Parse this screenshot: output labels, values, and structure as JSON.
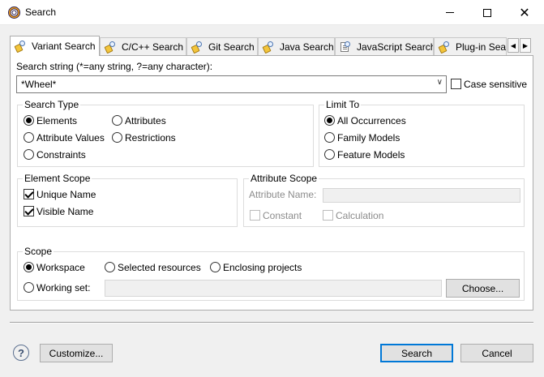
{
  "window": {
    "title": "Search"
  },
  "tabs": [
    {
      "label": "Variant Search",
      "icon": "search-wand-icon"
    },
    {
      "label": "C/C++ Search",
      "icon": "search-wand-icon"
    },
    {
      "label": "Git Search",
      "icon": "search-wand-icon"
    },
    {
      "label": "Java Search",
      "icon": "search-wand-icon"
    },
    {
      "label": "JavaScript Search",
      "icon": "document-search-icon"
    },
    {
      "label": "Plug-in Sea",
      "icon": "search-wand-icon"
    }
  ],
  "search": {
    "label": "Search string (*=any string, ?=any character):",
    "value": "*Wheel*",
    "case_sensitive_label": "Case sensitive",
    "case_sensitive": false
  },
  "search_type": {
    "title": "Search Type",
    "options": [
      "Elements",
      "Attributes",
      "Attribute Values",
      "Restrictions",
      "Constraints"
    ],
    "selected": "Elements"
  },
  "limit_to": {
    "title": "Limit To",
    "options": [
      "All Occurrences",
      "Family Models",
      "Feature Models"
    ],
    "selected": "All Occurrences"
  },
  "element_scope": {
    "title": "Element Scope",
    "unique_name": "Unique Name",
    "visible_name": "Visible Name",
    "unique_checked": true,
    "visible_checked": true
  },
  "attribute_scope": {
    "title": "Attribute Scope",
    "attribute_name_label": "Attribute Name:",
    "attribute_name_value": "",
    "constant": "Constant",
    "calculation": "Calculation"
  },
  "scope": {
    "title": "Scope",
    "workspace": "Workspace",
    "selected_resources": "Selected resources",
    "enclosing_projects": "Enclosing projects",
    "working_set": "Working set:",
    "working_set_value": "",
    "choose": "Choose...",
    "selected": "Workspace"
  },
  "footer": {
    "help": "?",
    "customize": "Customize...",
    "search": "Search",
    "cancel": "Cancel"
  },
  "colors": {
    "accent": "#0078d7",
    "panel": "#ffffff",
    "dialog": "#f0f0f0"
  }
}
